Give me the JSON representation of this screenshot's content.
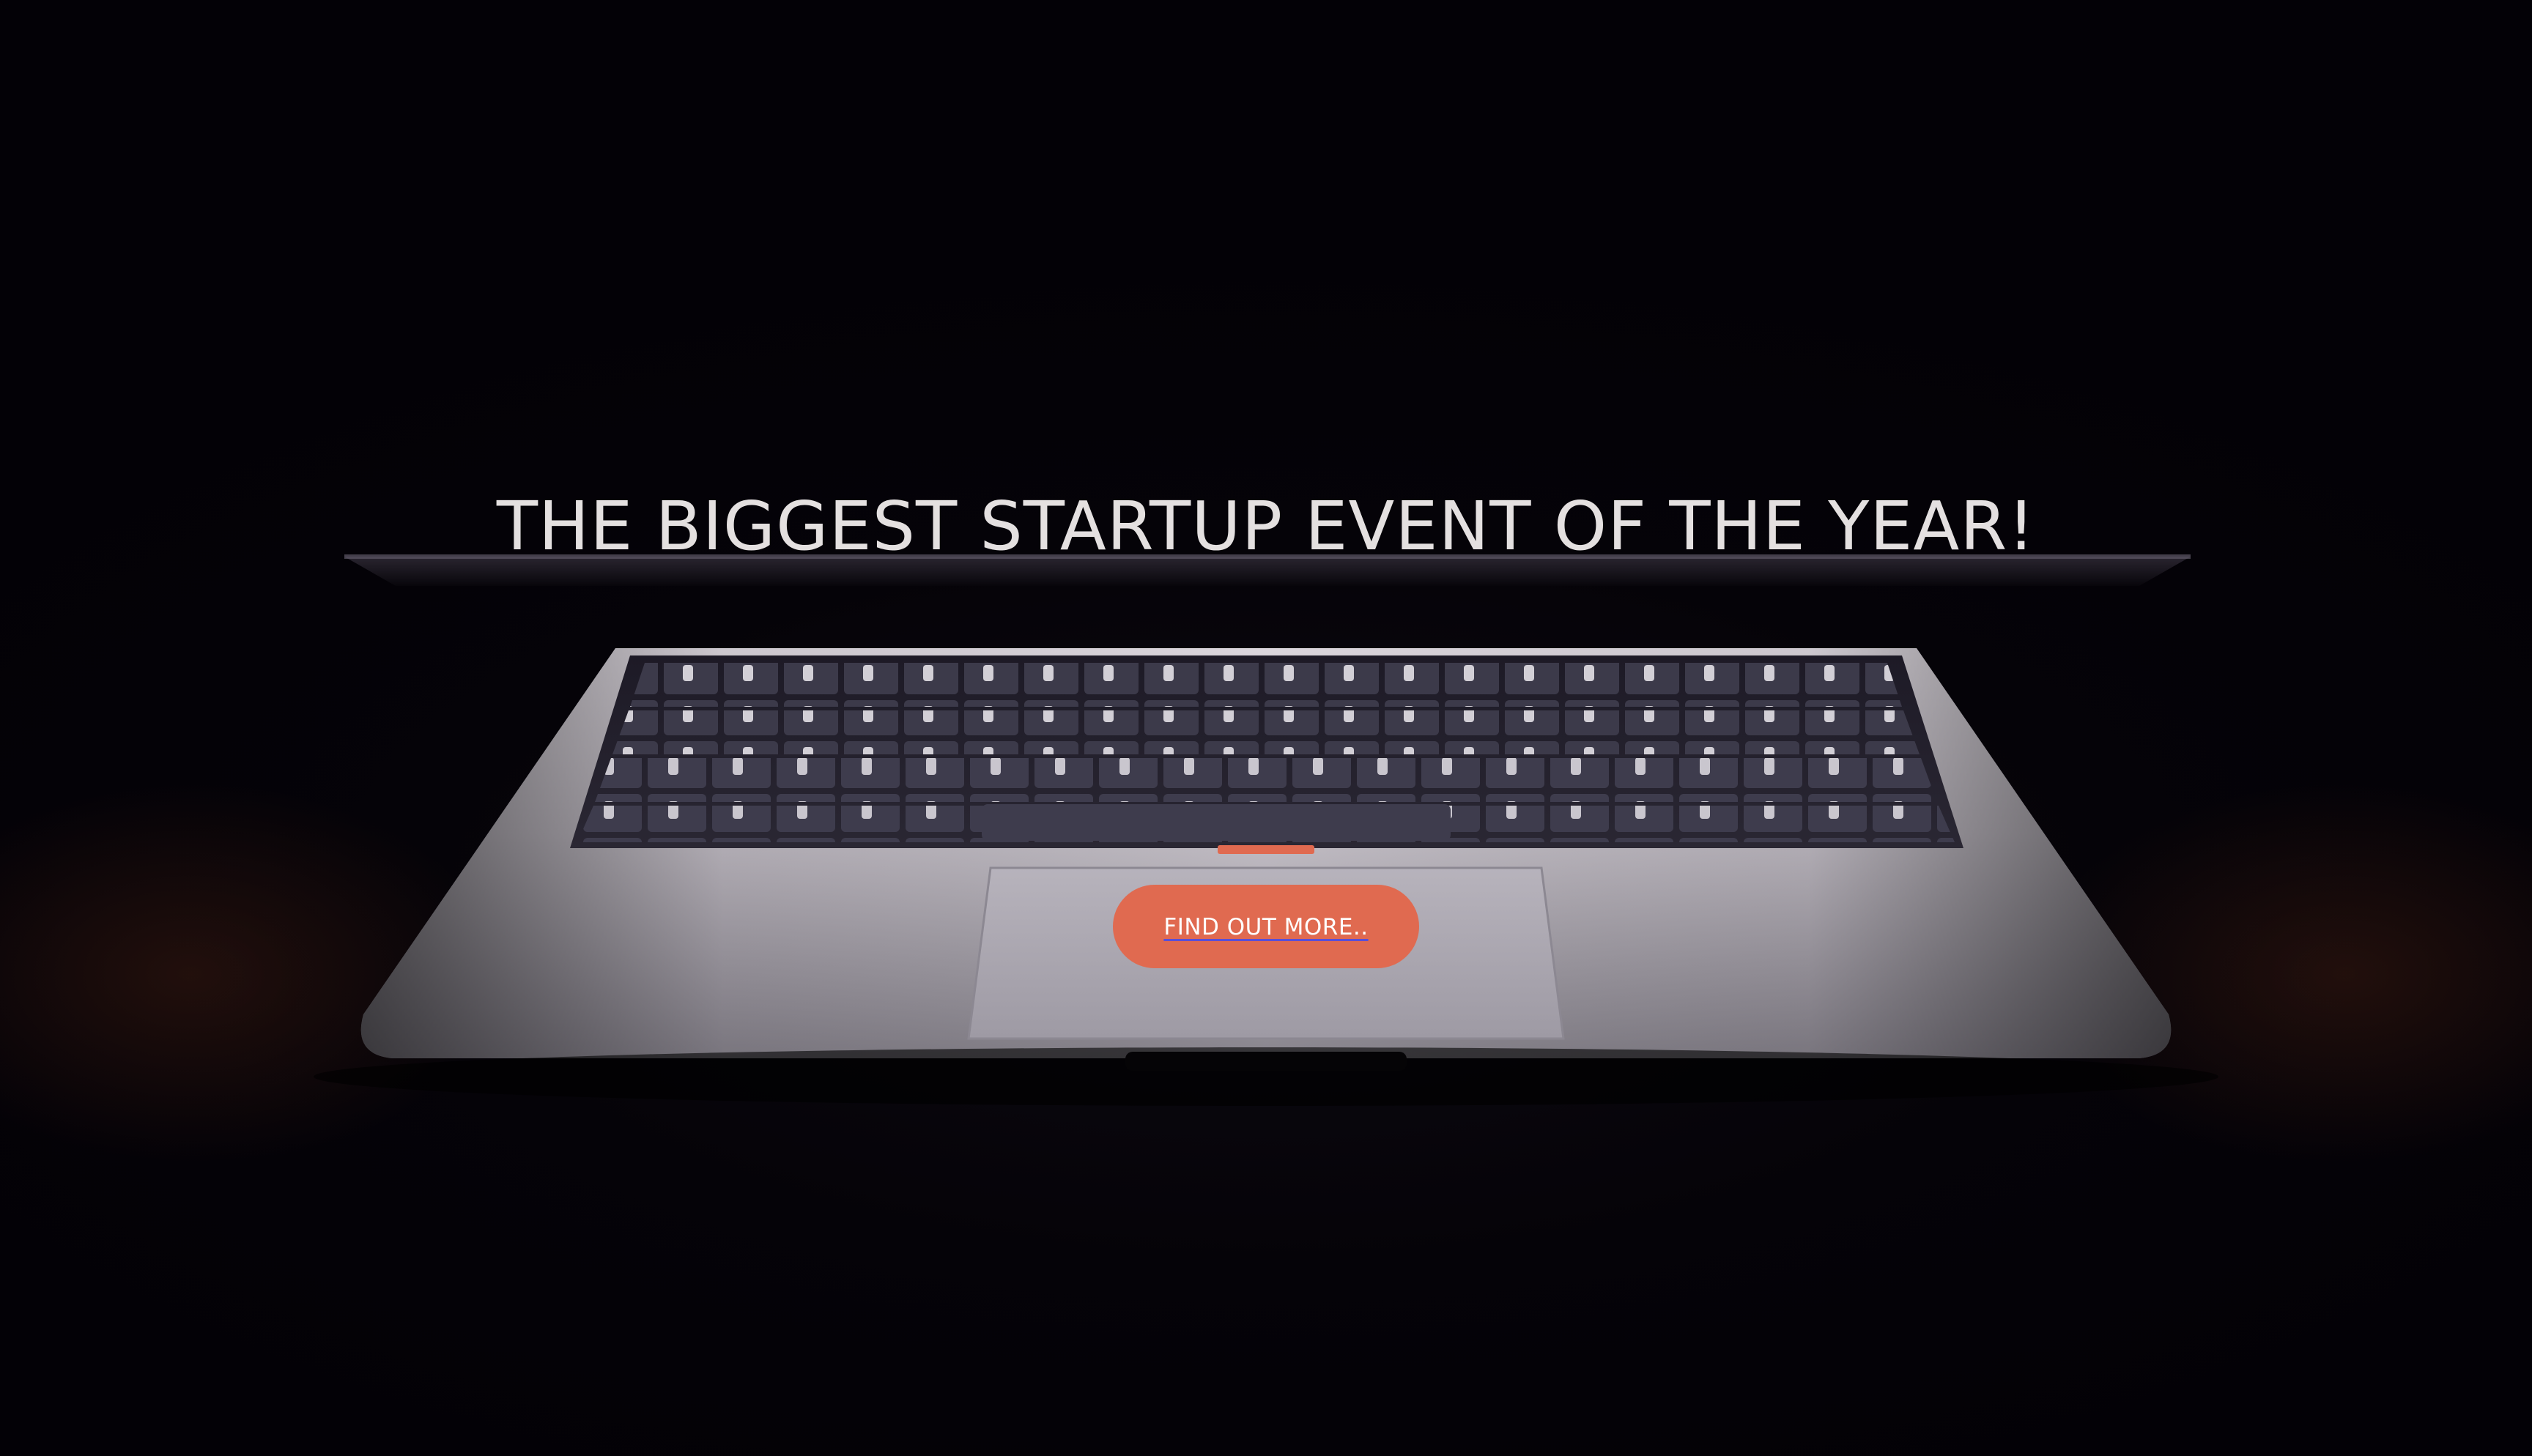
{
  "hero": {
    "headline": "THE BIGGEST STARTUP EVENT OF THE YEAR!",
    "cta_label": "FIND OUT MORE..",
    "background": "laptop-photo"
  },
  "colors": {
    "background": "#030106",
    "headline_text": "#e4e0e0",
    "cta_background": "#e06a50",
    "cta_text": "#ffffff",
    "cta_underline": "#5a4fd6"
  }
}
